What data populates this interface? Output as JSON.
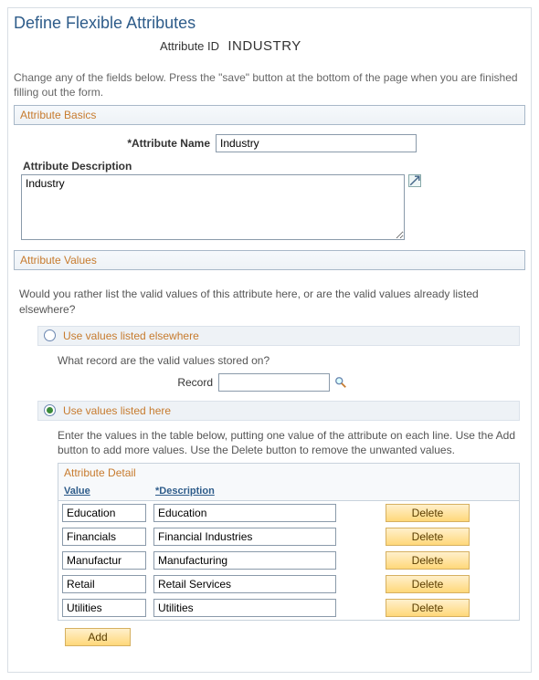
{
  "page_title": "Define Flexible Attributes",
  "attribute_id_label": "Attribute ID",
  "attribute_id_value": "INDUSTRY",
  "instructions": "Change any of the fields below. Press the \"save\" button at the bottom of the page when you are finished filling out the form.",
  "sections": {
    "basics": {
      "title": "Attribute Basics",
      "name_label": "*Attribute Name",
      "name_value": "Industry",
      "desc_label": "Attribute Description",
      "desc_value": "Industry"
    },
    "values": {
      "title": "Attribute Values",
      "question": "Would you rather list the valid values of this attribute here, or are the valid values already listed elsewhere?",
      "option_elsewhere": {
        "label": "Use values listed elsewhere",
        "sub_question": "What record are the valid values stored on?",
        "record_label": "Record",
        "record_value": ""
      },
      "option_here": {
        "label": "Use values listed here",
        "instructions": "Enter the values in the table below, putting one value of the attribute on each line. Use the Add button to add more values. Use the Delete button to remove the unwanted values.",
        "detail_title": "Attribute Detail",
        "columns": {
          "value": "Value",
          "description": "*Description"
        },
        "rows": [
          {
            "value": "Education",
            "description": "Education"
          },
          {
            "value": "Financials",
            "description": "Financial Industries"
          },
          {
            "value": "Manufactur",
            "description": "Manufacturing"
          },
          {
            "value": "Retail",
            "description": "Retail Services"
          },
          {
            "value": "Utilities",
            "description": "Utilities"
          }
        ],
        "delete_label": "Delete",
        "add_label": "Add"
      },
      "selected_option": "here"
    }
  }
}
